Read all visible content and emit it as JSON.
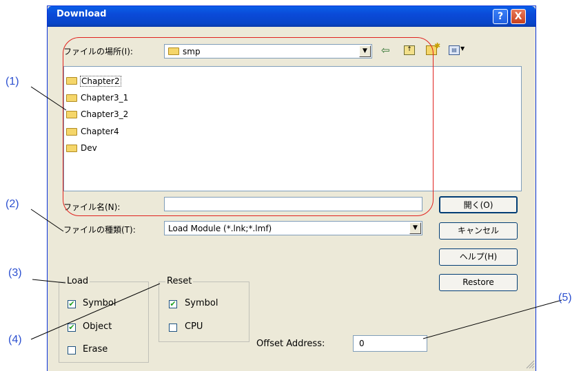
{
  "window": {
    "title": "Download",
    "help_label": "?",
    "close_label": "X"
  },
  "look_in": {
    "label": "ファイルの場所(I):",
    "value": "smp"
  },
  "file_list": {
    "items": [
      "Chapter2",
      "Chapter3_1",
      "Chapter3_2",
      "Chapter4",
      "Dev"
    ]
  },
  "file_name": {
    "label": "ファイル名(N):",
    "value": ""
  },
  "file_type": {
    "label": "ファイルの種類(T):",
    "value": "Load Module (*.lnk;*.lmf)"
  },
  "buttons": {
    "open": "開く(O)",
    "cancel": "キャンセル",
    "help": "ヘルプ(H)",
    "restore": "Restore"
  },
  "load_group": {
    "title": "Load",
    "symbol": {
      "label": "Symbol",
      "checked": true
    },
    "object": {
      "label": "Object",
      "checked": true
    },
    "erase": {
      "label": "Erase",
      "checked": false
    }
  },
  "reset_group": {
    "title": "Reset",
    "symbol": {
      "label": "Symbol",
      "checked": true
    },
    "cpu": {
      "label": "CPU",
      "checked": false
    }
  },
  "offset": {
    "label": "Offset Address:",
    "value": "0"
  },
  "annotations": {
    "a1": "(1)",
    "a2": "(2)",
    "a3": "(3)",
    "a4": "(4)",
    "a5": "(5)"
  },
  "colors": {
    "annotation": "#2b4fd0",
    "highlight": "#e0201c",
    "titlebar": "#0a4ad8",
    "dialog_bg": "#ece9d8"
  }
}
